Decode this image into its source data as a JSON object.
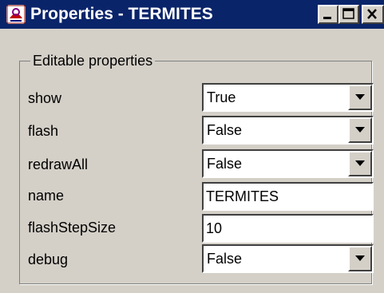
{
  "window": {
    "title": "Properties - TERMITES",
    "titlebar_color": "#0a246a",
    "background_color": "#d4d0c8",
    "controls": {
      "minimize_icon": "minimize-icon",
      "maximize_icon": "maximize-icon",
      "close_icon": "close-icon"
    }
  },
  "group": {
    "legend": "Editable properties"
  },
  "properties": {
    "show": {
      "label": "show",
      "value": "True",
      "type": "dropdown"
    },
    "flash": {
      "label": "flash",
      "value": "False",
      "type": "dropdown"
    },
    "redrawAll": {
      "label": "redrawAll",
      "value": "False",
      "type": "dropdown"
    },
    "name": {
      "label": "name",
      "value": "TERMITES",
      "type": "text"
    },
    "flashStepSize": {
      "label": "flashStepSize",
      "value": "10",
      "type": "text"
    },
    "debug": {
      "label": "debug",
      "value": "False",
      "type": "dropdown"
    }
  },
  "icons": {
    "app": "app-icon",
    "dropdown": "chevron-down-icon"
  }
}
